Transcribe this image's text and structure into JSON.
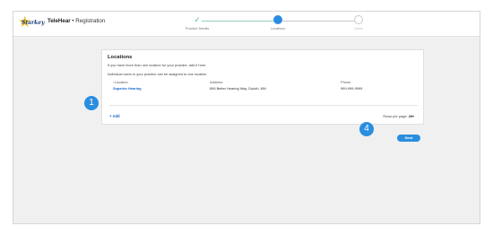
{
  "brand": {
    "logo_text": "Starkey",
    "app_name": "TeleHear",
    "separator": " • ",
    "section": "Registration"
  },
  "stepper": {
    "steps": [
      {
        "label": "Practice Details",
        "state": "done"
      },
      {
        "label": "Locations",
        "state": "active"
      },
      {
        "label": "Users",
        "state": "todo"
      }
    ],
    "check_glyph": "✓"
  },
  "card": {
    "title": "Locations",
    "desc1": "If you have more than one location for your practice, add it here.",
    "desc2": "Individual users in your practice can be assigned to one location.",
    "columns": [
      "Location",
      "Address",
      "Phone"
    ],
    "rows": [
      {
        "location": "Superior Hearing",
        "address": "896 Better Hearing Way, Duluth, MN",
        "phone": "999-999-9999"
      }
    ],
    "add_label": "+ Add",
    "rows_per_page_label": "Rows per page:",
    "rows_per_page_value": "20",
    "rows_per_page_caret": "▾"
  },
  "next_label": "Next",
  "annotations": [
    "1",
    "4"
  ],
  "colors": {
    "accent": "#2a8ee0",
    "link": "#1b64c9",
    "done": "#5cb88f"
  }
}
